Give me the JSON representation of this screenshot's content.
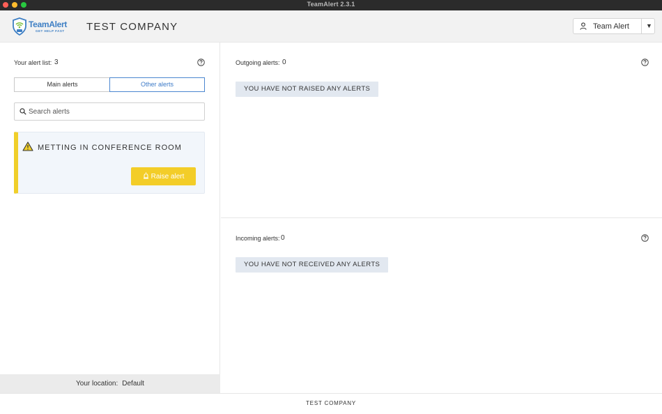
{
  "window": {
    "title": "TeamAlert 2.3.1"
  },
  "header": {
    "logo_name": "TeamAlert",
    "logo_tagline": "GET HELP FAST",
    "company": "TEST COMPANY",
    "user_name": "Team Alert",
    "user_caret": "▼"
  },
  "alert_list": {
    "label": "Your alert list:",
    "count": "3",
    "tabs": [
      {
        "label": "Main alerts",
        "active": false
      },
      {
        "label": "Other alerts",
        "active": true
      }
    ],
    "search_placeholder": "Search alerts",
    "alerts": [
      {
        "title": "METTING IN CONFERENCE ROOM",
        "button_label": "Raise alert",
        "accent_color": "#f0cf2a"
      }
    ]
  },
  "location": {
    "label": "Your location:",
    "value": "Default"
  },
  "outgoing": {
    "label": "Outgoing alerts:",
    "count": "0",
    "empty_message": "YOU HAVE NOT RAISED ANY ALERTS"
  },
  "incoming": {
    "label": "Incoming alerts:",
    "count": "0",
    "empty_message": "YOU HAVE NOT RECEIVED ANY ALERTS"
  },
  "footer": {
    "text": "TEST COMPANY"
  },
  "icons": {
    "help": "question-circle-icon",
    "search": "magnifier-icon",
    "warning": "warning-triangle-icon",
    "raise": "alarm-light-icon",
    "user": "person-icon"
  },
  "colors": {
    "accent_blue": "#3e7fc4",
    "alert_yellow": "#f3cd28",
    "badge_bg": "#e2e8f0"
  }
}
